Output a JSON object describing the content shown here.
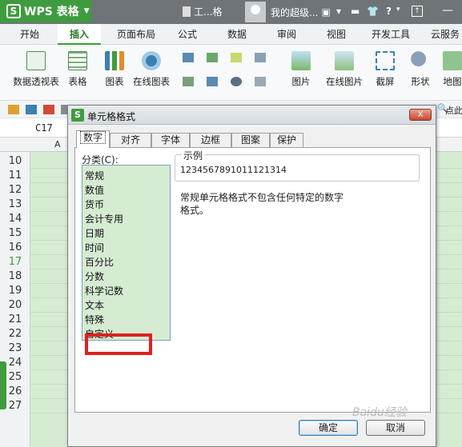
{
  "app": {
    "name": "WPS 表格",
    "logo_letter": "S",
    "doc_title": "工...格",
    "user_name": "我的超级...",
    "help_label": "?"
  },
  "menu": {
    "tabs": [
      "开始",
      "插入",
      "页面布局",
      "公式",
      "数据",
      "审阅",
      "视图",
      "开发工具",
      "云服务"
    ],
    "active": "插入"
  },
  "ribbon": {
    "items": [
      "数据透视表",
      "表格",
      "图表",
      "在线图表",
      "图片",
      "在线图片",
      "截屏",
      "形状",
      "地图"
    ]
  },
  "quickbar": {
    "right_label": "点此"
  },
  "formula": {
    "cell_ref": "C17"
  },
  "sheet": {
    "column_header": "A",
    "rows": [
      "10",
      "11",
      "12",
      "13",
      "14",
      "15",
      "16",
      "17",
      "18",
      "19",
      "20",
      "21",
      "22",
      "23",
      "24",
      "25",
      "26",
      "27"
    ],
    "active_row": "17"
  },
  "dialog": {
    "title": "单元格格式",
    "close_label": "X",
    "tabs": [
      "数字",
      "对齐",
      "字体",
      "边框",
      "图案",
      "保护"
    ],
    "active_tab": "数字",
    "category_label": "分类(C):",
    "categories": [
      "常规",
      "数值",
      "货币",
      "会计专用",
      "日期",
      "时间",
      "百分比",
      "分数",
      "科学记数",
      "文本",
      "特殊",
      "自定义"
    ],
    "highlighted_category": "文本",
    "sample_label": "示例",
    "sample_value": "1234567891011121314",
    "description_line1": "常规单元格格式不包含任何特定的数字",
    "description_line2": "格式。",
    "ok_label": "确定",
    "cancel_label": "取消"
  },
  "watermark": "Baidu经验",
  "colors": {
    "brand_green": "#3e9c3e",
    "highlight_red": "#e02020",
    "sheet_fill": "#d5ecd2"
  }
}
